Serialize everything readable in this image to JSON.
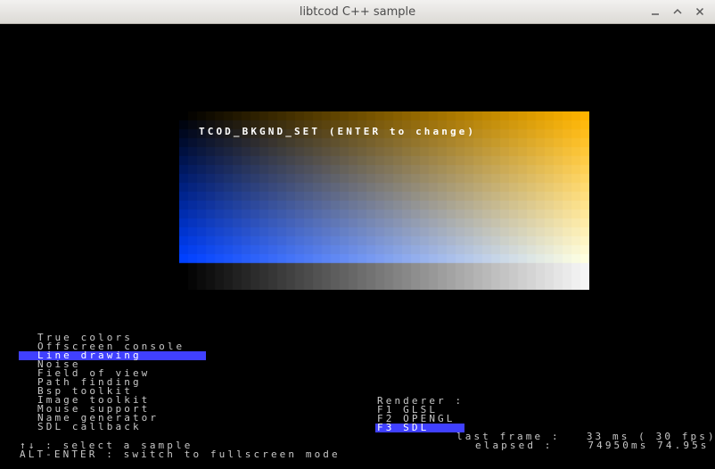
{
  "window": {
    "title": "libtcod C++ sample"
  },
  "sample": {
    "label": "TCOD_BKGND_SET (ENTER to change)",
    "colors": {
      "top_left": "#000000",
      "top_right": "#ffb400",
      "bottom_left": "#0040ff",
      "bottom_right": "#ffffe0"
    }
  },
  "menu": {
    "items": [
      {
        "label": "True colors",
        "selected": false
      },
      {
        "label": "Offscreen console",
        "selected": false
      },
      {
        "label": "Line drawing",
        "selected": true
      },
      {
        "label": "Noise",
        "selected": false
      },
      {
        "label": "Field of view",
        "selected": false
      },
      {
        "label": "Path finding",
        "selected": false
      },
      {
        "label": "Bsp toolkit",
        "selected": false
      },
      {
        "label": "Image toolkit",
        "selected": false
      },
      {
        "label": "Mouse support",
        "selected": false
      },
      {
        "label": "Name generator",
        "selected": false
      },
      {
        "label": "SDL callback",
        "selected": false
      }
    ],
    "highlight_color": "#4040ff"
  },
  "renderer": {
    "header": "Renderer :",
    "options": [
      {
        "label": "F1 GLSL",
        "selected": false
      },
      {
        "label": "F2 OPENGL",
        "selected": false
      },
      {
        "label": "F3 SDL",
        "selected": true
      }
    ]
  },
  "stats": {
    "last_frame": "last frame :   33 ms ( 30 fps)",
    "elapsed": "elapsed :    74950ms 74.95s"
  },
  "help": {
    "select_sample": "↑↓ : select a sample",
    "fullscreen": "ALT-ENTER : switch to fullscreen mode"
  }
}
